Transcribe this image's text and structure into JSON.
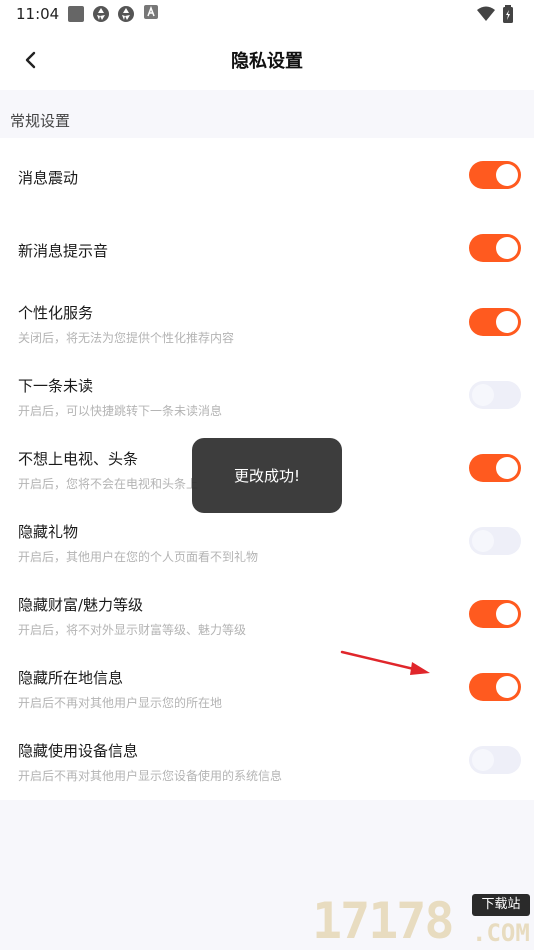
{
  "status_bar": {
    "time": "11:04",
    "left_icons": [
      "square-app-icon",
      "aperture-icon",
      "aperture-icon",
      "a-badge-icon"
    ],
    "right_icons": [
      "wifi-icon",
      "battery-charging-icon"
    ]
  },
  "nav": {
    "title": "隐私设置",
    "back_icon": "chevron-left-icon"
  },
  "section": {
    "title": "常规设置"
  },
  "settings": [
    {
      "title": "消息震动",
      "desc": "",
      "enabled": true
    },
    {
      "title": "新消息提示音",
      "desc": "",
      "enabled": true
    },
    {
      "title": "个性化服务",
      "desc": "关闭后，将无法为您提供个性化推荐内容",
      "enabled": true
    },
    {
      "title": "下一条未读",
      "desc": "开启后，可以快捷跳转下一条未读消息",
      "enabled": false
    },
    {
      "title": "不想上电视、头条",
      "desc": "开启后，您将不会在电视和头条上",
      "enabled": true
    },
    {
      "title": "隐藏礼物",
      "desc": "开启后，其他用户在您的个人页面看不到礼物",
      "enabled": false
    },
    {
      "title": "隐藏财富/魅力等级",
      "desc": "开启后，将不对外显示财富等级、魅力等级",
      "enabled": true
    },
    {
      "title": "隐藏所在地信息",
      "desc": "开启后不再对其他用户显示您的所在地",
      "enabled": true
    },
    {
      "title": "隐藏使用设备信息",
      "desc": "开启后不再对其他用户显示您设备使用的系统信息",
      "enabled": false
    }
  ],
  "toast": {
    "text": "更改成功!"
  },
  "watermark": {
    "number": "17178",
    "tag": "下载站",
    "domain": ".COM"
  },
  "colors": {
    "accent": "#ff5a1f",
    "toggle_off": "#eeeff8",
    "annotation_arrow": "#e0262b"
  }
}
